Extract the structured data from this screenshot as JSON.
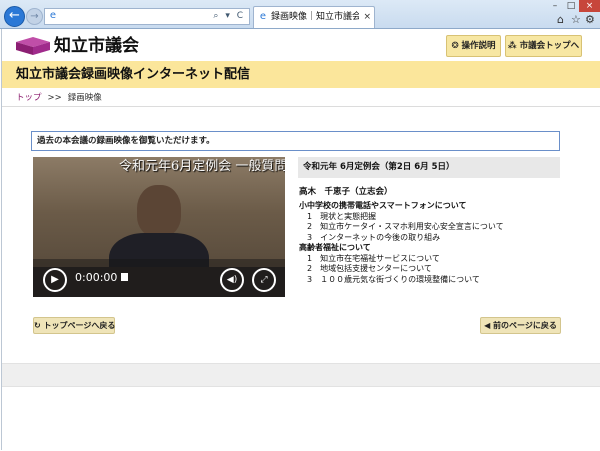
{
  "browser": {
    "back_icon": "arrow-left-icon",
    "forward_icon": "arrow-right-icon",
    "address_tools": "⌕ ▾ C",
    "tab_title": "録画映像｜知立市議会イン...",
    "tab_close": "×",
    "window_min": "–",
    "window_max": "□",
    "window_close": "×",
    "accent": "#2b78d6"
  },
  "header": {
    "site_title": "知立市議会",
    "ops_button": "操作説明",
    "top_button": "市議会トップへ",
    "brand_color": "#a02b8c"
  },
  "banner": {
    "title": "知立市議会録画映像インターネット配信"
  },
  "breadcrumb": {
    "home": "トップ",
    "separator": ">>",
    "current": "録画映像"
  },
  "notice": "過去の本会議の録画映像を御覧いただけます。",
  "video": {
    "caption": "令和元年6月定例会 一般質問",
    "time": "0:00:00"
  },
  "session": "令和元年 6月定例会（第2日 6月 5日）",
  "speaker": "高木　千恵子（立志会）",
  "agenda": [
    {
      "topic": "小中学校の携帯電話やスマートフォンについて",
      "items": [
        "1　現状と実態把握",
        "2　知立市ケータイ・スマホ利用安心安全宣言について",
        "3　インターネットの今後の取り組み"
      ]
    },
    {
      "topic": "高齢者福祉について",
      "items": [
        "1　知立市在宅福祉サービスについて",
        "2　地域包括支援センターについて",
        "3　１００歳元気な街づくりの環境整備について"
      ]
    }
  ],
  "nav": {
    "back_to_top": "トップページへ戻る",
    "prev_page": "前のページに戻る"
  }
}
